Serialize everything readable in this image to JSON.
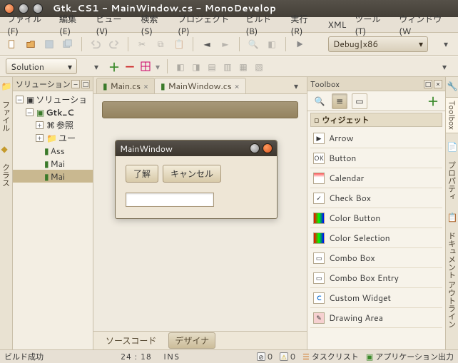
{
  "titlebar": {
    "title": "Gtk_CS1 - MainWindow.cs - MonoDevelop"
  },
  "menubar": {
    "file": "ファイル (F)",
    "edit": "編集 (E)",
    "view": "ビュー (V)",
    "search": "検索 (S)",
    "project": "プロジェクト (P)",
    "build": "ビルド (B)",
    "run": "実行 (R)",
    "xml": "XML",
    "tools": "ツール (T)",
    "window": "ウィンドウ (W"
  },
  "toolbar": {
    "config": "Debug|x86"
  },
  "toolbar2": {
    "combo": "Solution"
  },
  "solution": {
    "header": "ソリューション",
    "root": "ソリューショ",
    "proj": "Gtk_C",
    "ref": "参照",
    "ui": "ユー",
    "asm": "Ass",
    "main": "Mai",
    "mainwin": "Mai"
  },
  "sidetabs": {
    "left1": "ファイル",
    "left2": "クラス",
    "right1": "Toolbox",
    "right2": "プロパティ",
    "right3": "ドキュメント アウトライン"
  },
  "tabs": {
    "t1": "Main.cs",
    "t2": "MainWindow.cs"
  },
  "designer": {
    "window_title": "MainWindow",
    "btn_ok": "了解",
    "btn_cancel": "キャンセル",
    "mode_source": "ソースコード",
    "mode_designer": "デザイナ"
  },
  "toolbox": {
    "header": "Toolbox",
    "category": "ウィジェット",
    "items": [
      "Arrow",
      "Button",
      "Calendar",
      "Check Box",
      "Color Button",
      "Color Selection",
      "Combo Box",
      "Combo Box Entry",
      "Custom Widget",
      "Drawing Area"
    ]
  },
  "status": {
    "build": "ビルド成功",
    "pos": "24 : 18",
    "ins": "INS",
    "err": "0",
    "warn": "0",
    "tasklist": "タスクリスト",
    "appout": "アプリケーション出力"
  }
}
